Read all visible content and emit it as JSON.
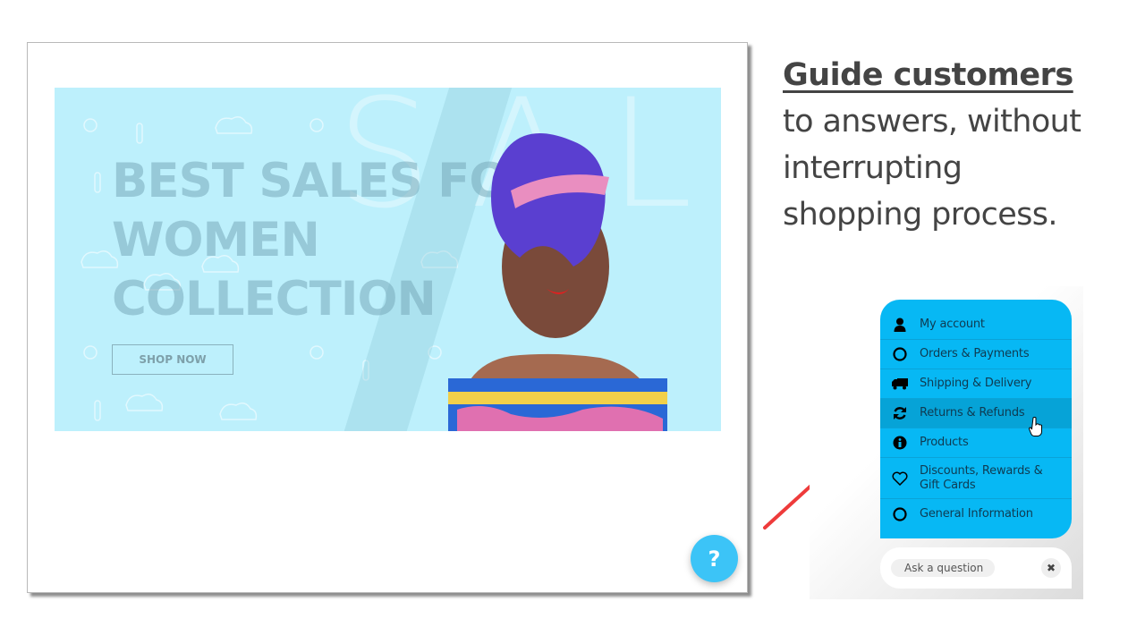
{
  "banner": {
    "headline_lines": [
      "BEST SALES FOR",
      "WOMEN",
      "COLLECTION"
    ],
    "background_word": "SALE",
    "cta_label": "SHOP NOW",
    "bg_color": "#bdf0fc"
  },
  "help_button": {
    "icon": "question-icon",
    "glyph": "?",
    "color": "#3cc4f7"
  },
  "promo": {
    "bold_text": "Guide customers",
    "rest_lines": [
      "to answers, without",
      "interrupting",
      "shopping process."
    ]
  },
  "widget": {
    "accent_color": "#07b8f4",
    "menu_items": [
      {
        "label": "My account",
        "icon": "user-icon"
      },
      {
        "label": "Orders & Payments",
        "icon": "circle-icon"
      },
      {
        "label": "Shipping & Delivery",
        "icon": "truck-icon"
      },
      {
        "label": "Returns & Refunds",
        "icon": "refresh-icon",
        "active": true
      },
      {
        "label": "Products",
        "icon": "info-icon"
      },
      {
        "label": "Discounts, Rewards & Gift Cards",
        "icon": "heart-icon"
      },
      {
        "label": "General Information",
        "icon": "circle-icon"
      }
    ],
    "ask_placeholder": "Ask a question",
    "close_icon": "close-icon"
  },
  "annotation": {
    "arrow_color": "#ee3b3b"
  }
}
